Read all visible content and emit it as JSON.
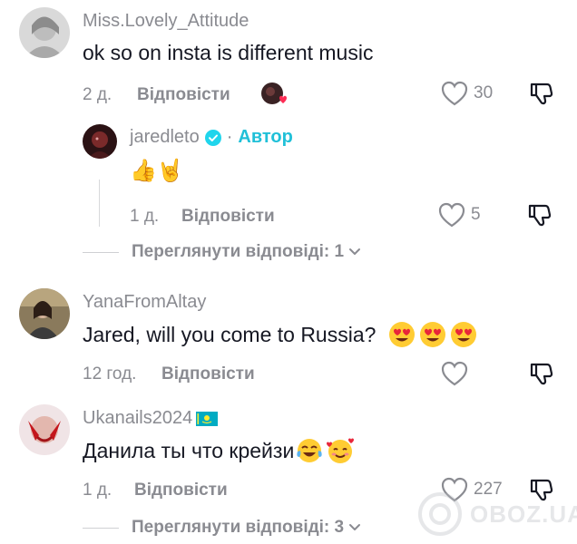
{
  "comments": [
    {
      "username": "Miss.Lovely_Attitude",
      "text": "ok so on insta is different music",
      "time": "2 д.",
      "reply_label": "Відповісти",
      "likes": "30"
    },
    {
      "username": "YanaFromAltay",
      "text": "Jared, will you come to Russia?",
      "time": "12 год.",
      "reply_label": "Відповісти",
      "likes": ""
    },
    {
      "username": "Ukanails2024",
      "text": "Данила ты что крейзи",
      "time": "1 д.",
      "reply_label": "Відповісти",
      "likes": "227"
    }
  ],
  "reply": {
    "username": "jaredleto",
    "separator": "·",
    "author_label": "Автор",
    "text": "👍🤘",
    "time": "1 д.",
    "reply_label": "Відповісти",
    "likes": "5"
  },
  "view_replies": [
    {
      "label": "Переглянути відповіді: 1"
    },
    {
      "label": "Переглянути відповіді: 3"
    }
  ],
  "watermark": {
    "text": "OBOZ.UA"
  },
  "colors": {
    "text": "#161823",
    "secondary": "#8a8b91",
    "author_accent": "#20c0d8",
    "verified": "#20d5ec",
    "heart_red": "#fe2c55"
  },
  "icons": {
    "like": "heart-outline-icon",
    "dislike": "thumbs-down-icon",
    "verified": "verified-badge-icon",
    "chevron": "chevron-down-icon",
    "flag": "kazakhstan-flag-icon",
    "creator_liked": "creator-liked-avatar-icon"
  }
}
